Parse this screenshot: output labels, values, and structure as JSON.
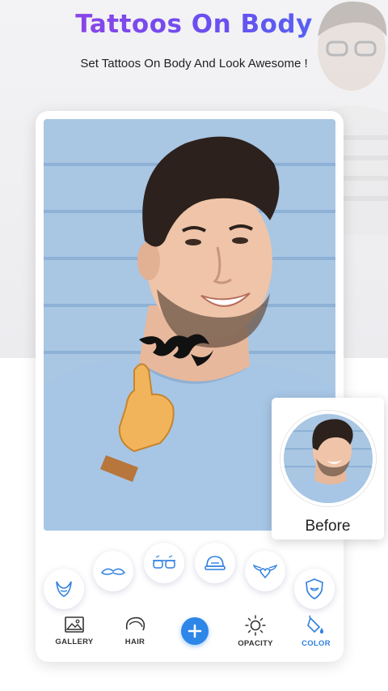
{
  "header": {
    "title": "Tattoos On Body",
    "subtitle": "Set Tattoos On Body And Look Awesome !"
  },
  "before_card": {
    "label": "Before"
  },
  "tools": [
    {
      "icon": "beard-icon"
    },
    {
      "icon": "mustache-icon"
    },
    {
      "icon": "glasses-icon"
    },
    {
      "icon": "cap-icon"
    },
    {
      "icon": "winged-heart-icon"
    },
    {
      "icon": "shield-badge-icon"
    }
  ],
  "bottom_nav": {
    "gallery": "GALLERY",
    "hair": "HAIR",
    "opacity": "OPACITY",
    "color": "COLOR"
  },
  "colors": {
    "accent": "#2d86e8",
    "title_gradient_start": "#9b3fe2",
    "title_gradient_end": "#4a6ef5",
    "active_nav": "#2f7fe0"
  }
}
